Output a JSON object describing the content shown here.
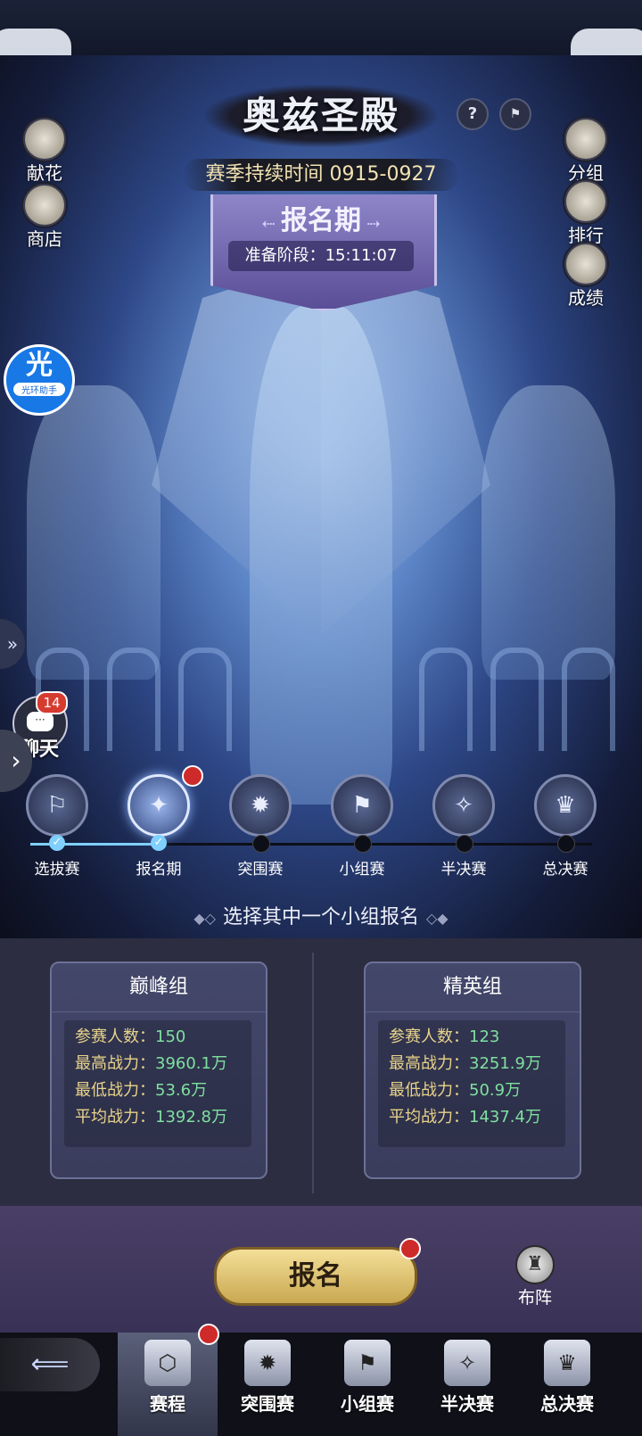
{
  "header": {
    "title": "奥兹圣殿",
    "help_icon": "?",
    "season": "赛季持续时间 0915-0927",
    "phase": "报名期",
    "countdown": "准备阶段：15:11:07"
  },
  "left_buttons": [
    {
      "label": "献花",
      "icon": "flower-icon"
    },
    {
      "label": "商店",
      "icon": "cards-icon"
    }
  ],
  "right_buttons": [
    {
      "label": "分组",
      "icon": "hooded-figure-icon"
    },
    {
      "label": "排行",
      "icon": "crown-icon"
    },
    {
      "label": "成绩",
      "icon": "scroll-icon"
    }
  ],
  "assistant": {
    "glyph": "光",
    "label": "光环助手"
  },
  "chat": {
    "badge": "14",
    "label": "聊天"
  },
  "stages": [
    {
      "label": "选拔赛",
      "done": true
    },
    {
      "label": "报名期",
      "done": true,
      "active": true
    },
    {
      "label": "突围赛",
      "done": false
    },
    {
      "label": "小组赛",
      "done": false
    },
    {
      "label": "半决赛",
      "done": false
    },
    {
      "label": "总决赛",
      "done": false
    }
  ],
  "choose_text": "选择其中一个小组报名",
  "groups": [
    {
      "name": "巅峰组",
      "rows": [
        {
          "k": "参赛人数：",
          "v": "150"
        },
        {
          "k": "最高战力：",
          "v": "3960.1万"
        },
        {
          "k": "最低战力：",
          "v": "53.6万"
        },
        {
          "k": "平均战力：",
          "v": "1392.8万"
        }
      ]
    },
    {
      "name": "精英组",
      "rows": [
        {
          "k": "参赛人数：",
          "v": "123"
        },
        {
          "k": "最高战力：",
          "v": "3251.9万"
        },
        {
          "k": "最低战力：",
          "v": "50.9万"
        },
        {
          "k": "平均战力：",
          "v": "1437.4万"
        }
      ]
    }
  ],
  "signup_button": "报名",
  "lineup": "布阵",
  "nav": [
    {
      "label": "赛程",
      "active": true
    },
    {
      "label": "突围赛"
    },
    {
      "label": "小组赛"
    },
    {
      "label": "半决赛"
    },
    {
      "label": "总决赛"
    }
  ],
  "colors": {
    "accent_gold": "#f2e3b2",
    "value_green": "#7ee0a0",
    "badge_red": "#cf2a2a",
    "progress_blue": "#7fd0ff"
  }
}
